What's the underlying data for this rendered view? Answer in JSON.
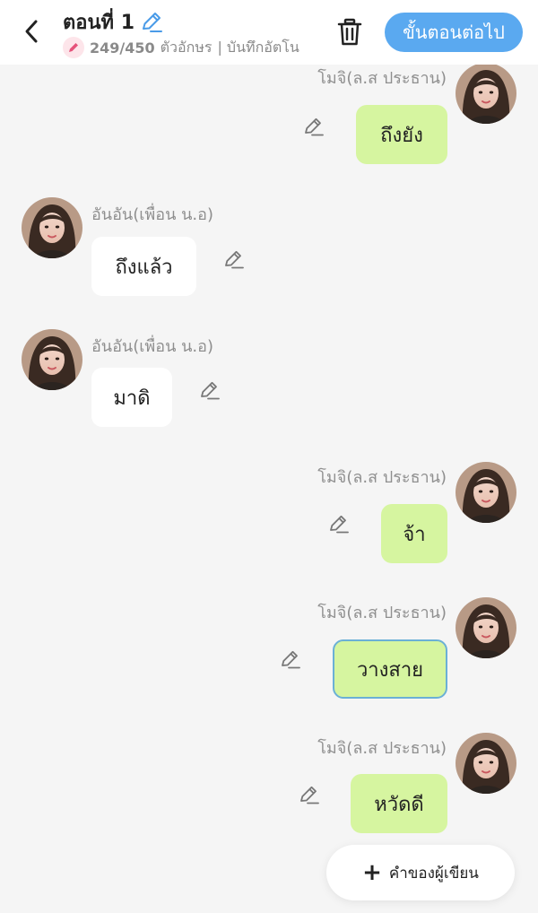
{
  "header": {
    "title": "ตอนที่ 1",
    "char_count": "249/450",
    "char_unit": "ตัวอักษร",
    "autosave": "| บันทึกอัตโน",
    "next_label": "ขั้นตอนต่อไป"
  },
  "messages": [
    {
      "side": "right",
      "sender": "โมจิ(ล.ส ประธาน)",
      "text": "ถึงยัง"
    },
    {
      "side": "left",
      "sender": "อันอัน(เพื่อน น.อ)",
      "text": "ถึงแล้ว"
    },
    {
      "side": "left",
      "sender": "อันอัน(เพื่อน น.อ)",
      "text": "มาดิ"
    },
    {
      "side": "right",
      "sender": "โมจิ(ล.ส ประธาน)",
      "text": "จ้า"
    },
    {
      "side": "right",
      "sender": "โมจิ(ล.ส ประธาน)",
      "text": "วางสาย",
      "selected": true
    },
    {
      "side": "right",
      "sender": "โมจิ(ล.ส ประธาน)",
      "text": "หวัดดี"
    }
  ],
  "author_note_label": "คำของผู้เขียน",
  "icons": {
    "back": "chevron-left-icon",
    "edit": "pencil-icon",
    "trash": "trash-icon",
    "plus": "plus-icon"
  },
  "colors": {
    "primary": "#5aa9f0",
    "bubble_right": "#d6f5a0",
    "bubble_left": "#ffffff",
    "background": "#f5f5f5",
    "selected_border": "#6bb0d6"
  }
}
